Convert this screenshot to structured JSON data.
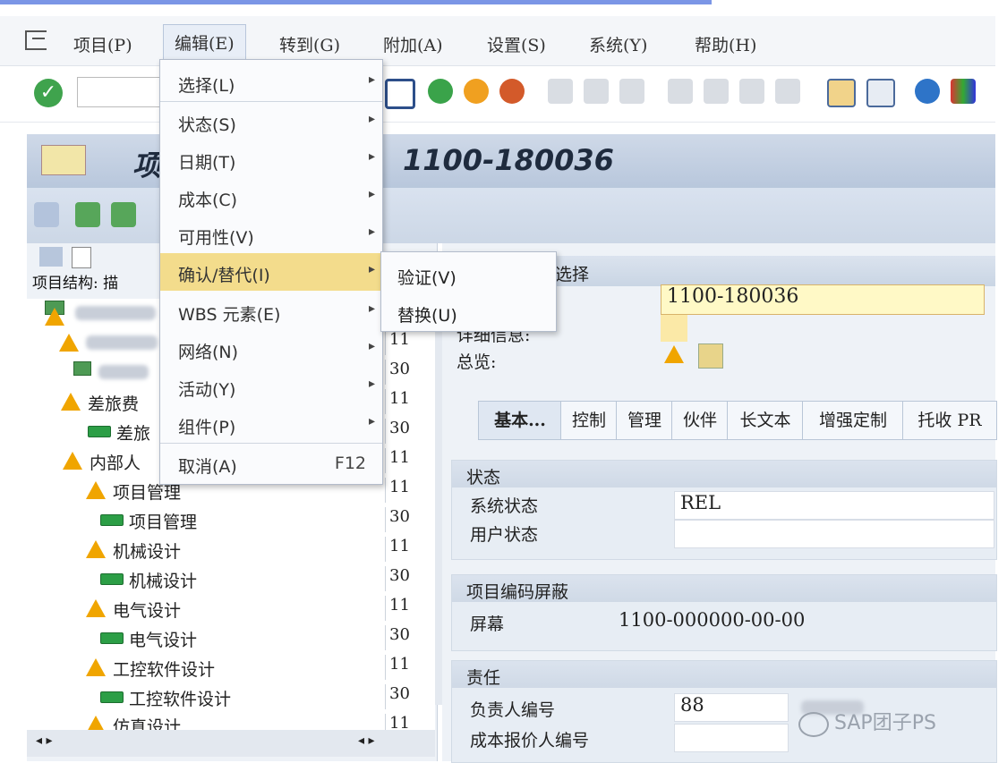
{
  "menubar": {
    "items": [
      "项目(P)",
      "编辑(E)",
      "转到(G)",
      "附加(A)",
      "设置(S)",
      "系统(Y)",
      "帮助(H)"
    ],
    "active_index": 1
  },
  "title": {
    "left": "项",
    "right": "1100-180036"
  },
  "edit_menu": {
    "items": [
      {
        "label": "选择(L)",
        "submenu": true
      },
      {
        "label": "状态(S)",
        "submenu": true
      },
      {
        "label": "日期(T)",
        "submenu": true
      },
      {
        "label": "成本(C)",
        "submenu": true
      },
      {
        "label": "可用性(V)",
        "submenu": true
      },
      {
        "label": "确认/替代(I)",
        "submenu": true,
        "highlighted": true
      },
      {
        "label": "WBS 元素(E)",
        "submenu": true
      },
      {
        "label": "网络(N)",
        "submenu": true
      },
      {
        "label": "活动(Y)",
        "submenu": true
      },
      {
        "label": "组件(P)",
        "submenu": true
      },
      {
        "label": "取消(A)",
        "shortcut": "F12"
      }
    ]
  },
  "sub_menu": {
    "items": [
      "验证(V)",
      "替换(U)"
    ]
  },
  "tree": {
    "header": "项目结构: 描",
    "rows": [
      {
        "label": "",
        "num": "",
        "type": "project",
        "indent": 0
      },
      {
        "label": "",
        "num": "11",
        "type": "triangle",
        "indent": 1
      },
      {
        "label": "",
        "num": "30",
        "type": "green",
        "indent": 2
      },
      {
        "label": "差旅费",
        "num": "11",
        "type": "triangle",
        "indent": 1
      },
      {
        "label": "差旅",
        "num": "30",
        "type": "green",
        "indent": 2
      },
      {
        "label": "内部人",
        "num": "11",
        "type": "triangle",
        "indent": 1
      },
      {
        "label": "项目管理",
        "num": "11",
        "type": "triangle",
        "indent": 2
      },
      {
        "label": "项目管理",
        "num": "30",
        "type": "green",
        "indent": 3
      },
      {
        "label": "机械设计",
        "num": "11",
        "type": "triangle",
        "indent": 2
      },
      {
        "label": "机械设计",
        "num": "30",
        "type": "green",
        "indent": 3
      },
      {
        "label": "电气设计",
        "num": "11",
        "type": "triangle",
        "indent": 2
      },
      {
        "label": "电气设计",
        "num": "30",
        "type": "green",
        "indent": 3
      },
      {
        "label": "工控软件设计",
        "num": "11",
        "type": "triangle",
        "indent": 2
      },
      {
        "label": "工控软件设计",
        "num": "30",
        "type": "green",
        "indent": 3
      },
      {
        "label": "仿真设计",
        "num": "11",
        "type": "triangle",
        "indent": 2
      }
    ]
  },
  "detail": {
    "selection_title": "选择",
    "project_value": "1100-180036",
    "labels": {
      "detail_info": "详细信息:",
      "overview": "总览:"
    },
    "tabs": [
      "基本...",
      "控制",
      "管理",
      "伙伴",
      "长文本",
      "增强定制",
      "托收 PR"
    ],
    "status_group": {
      "title": "状态",
      "system_status_label": "系统状态",
      "system_status_value": "REL",
      "user_status_label": "用户状态",
      "user_status_value": ""
    },
    "mask_group": {
      "title": "项目编码屏蔽",
      "screen_label": "屏幕",
      "screen_value": "1100-000000-00-00"
    },
    "resp_group": {
      "title": "责任",
      "owner_label": "负责人编号",
      "owner_value": "88",
      "cost_label": "成本报价人编号",
      "cost_value": ""
    }
  },
  "watermark": "SAP团子PS"
}
